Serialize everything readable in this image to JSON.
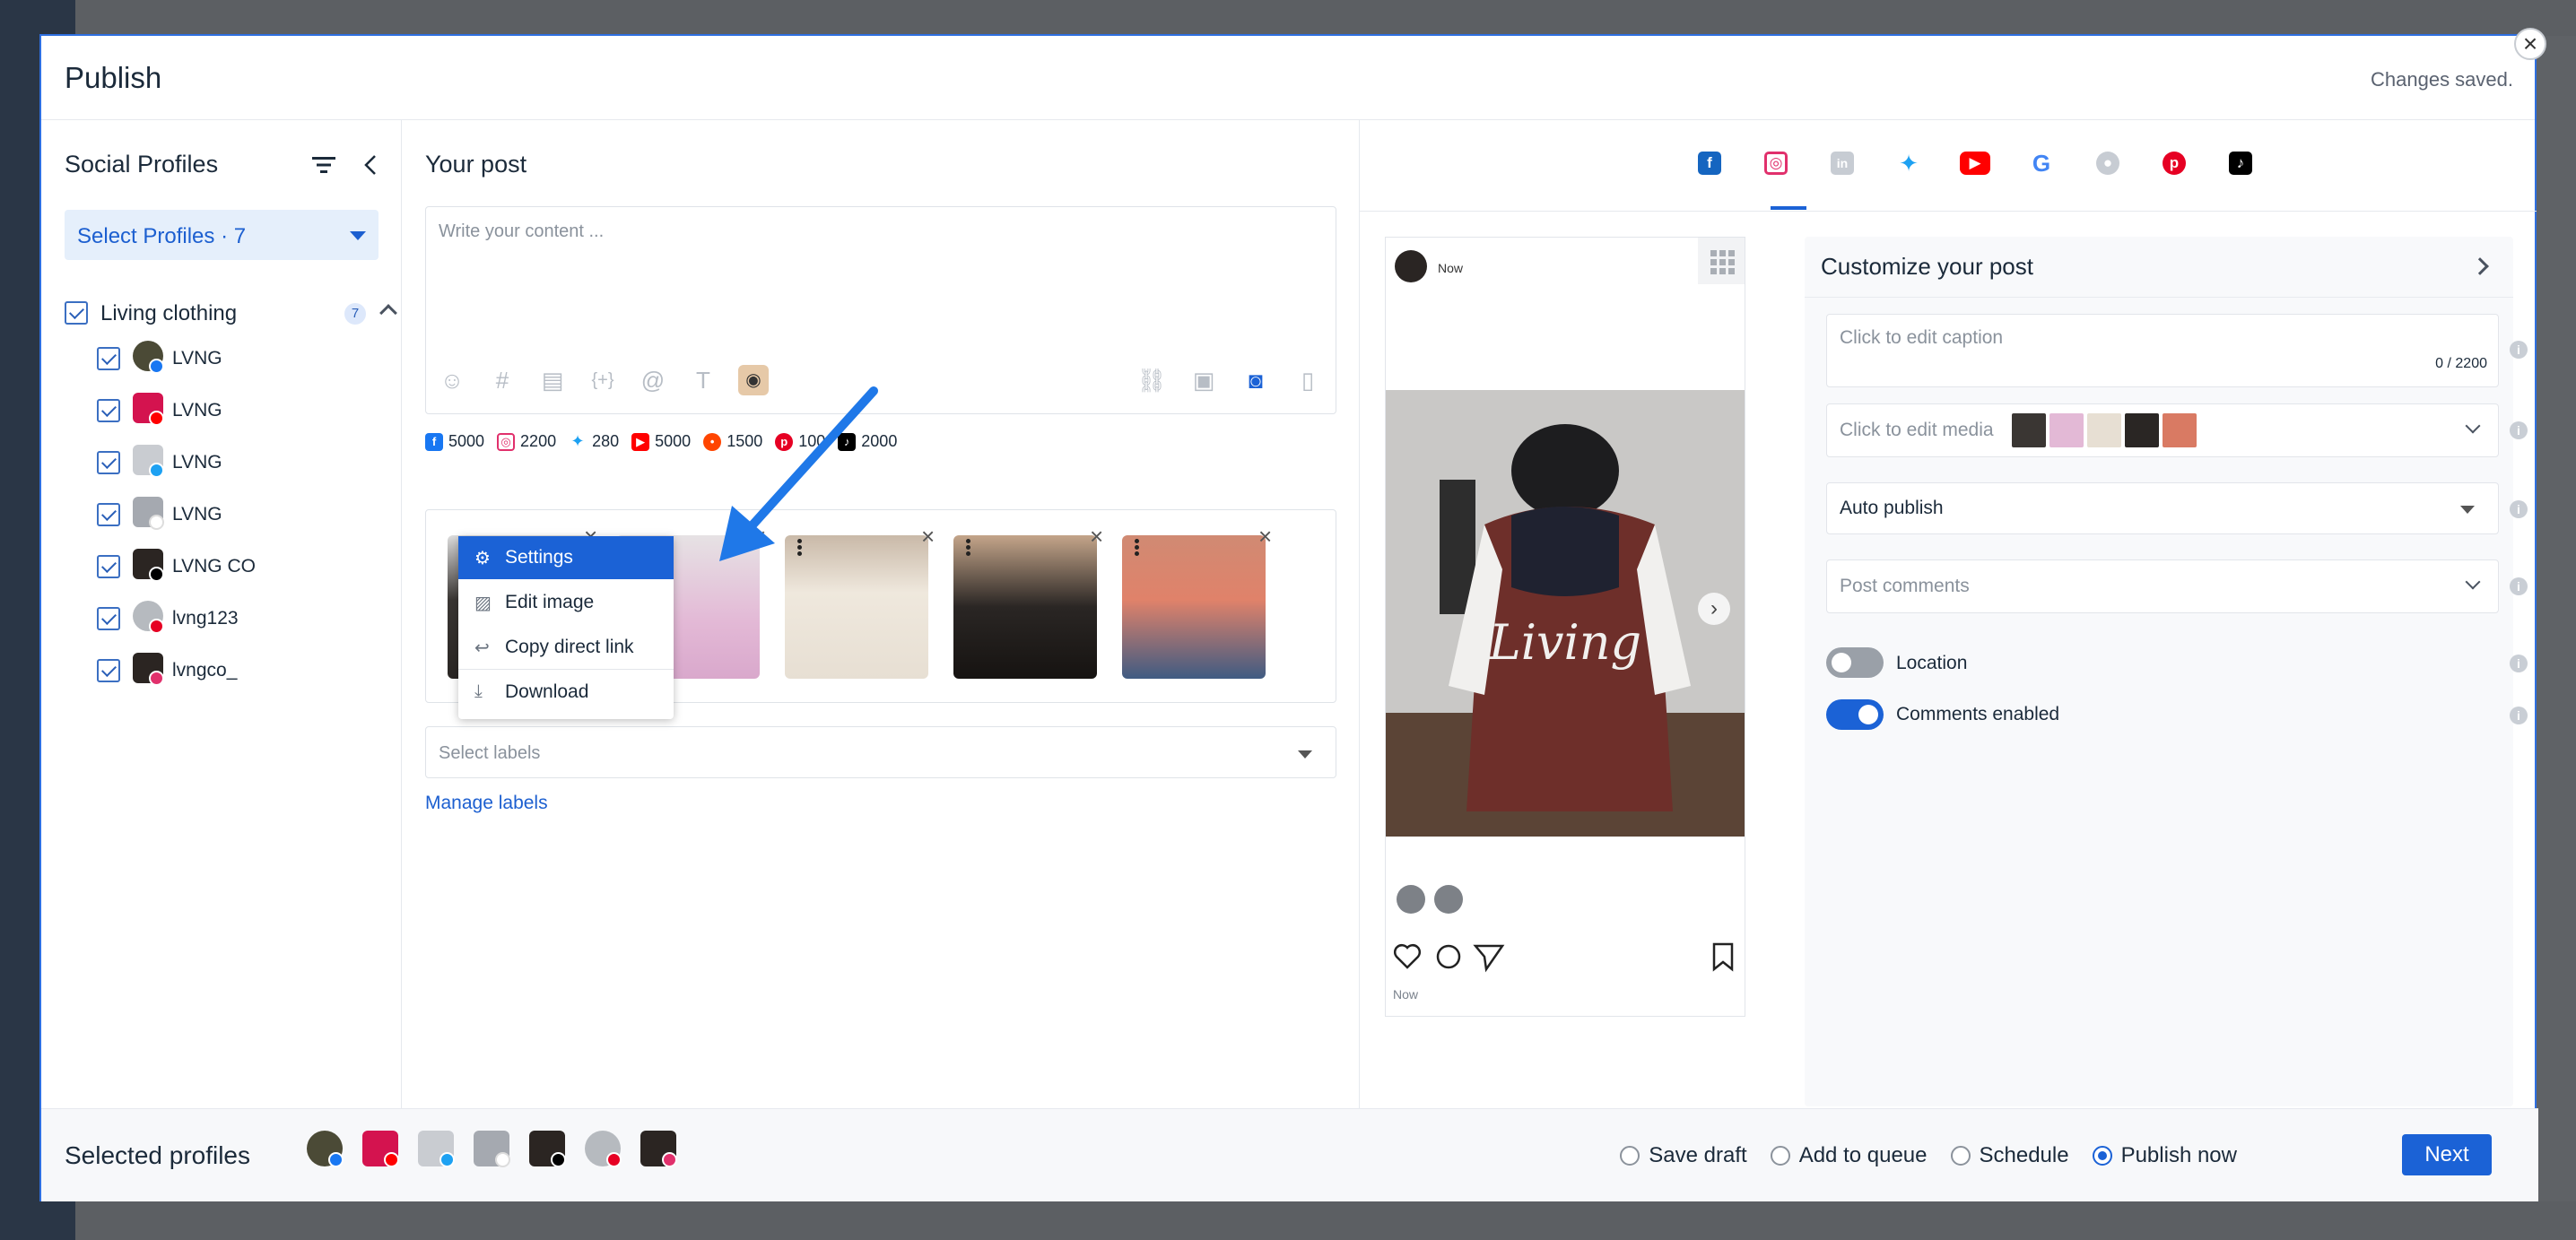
{
  "modal": {
    "title": "Publish",
    "status": "Changes saved."
  },
  "left": {
    "title": "Social Profiles",
    "select_label": "Select Profiles · 7",
    "group": {
      "name": "Living clothing",
      "count": "7"
    },
    "profiles": [
      {
        "name": "LVNG",
        "network": "facebook",
        "avatar_color": "#4b4a36"
      },
      {
        "name": "LVNG",
        "network": "youtube",
        "avatar_color": "#d4134f"
      },
      {
        "name": "LVNG",
        "network": "twitter",
        "avatar_color": "#c9ccd1"
      },
      {
        "name": "LVNG",
        "network": "google",
        "avatar_color": "#a5a9b0"
      },
      {
        "name": "LVNG CO",
        "network": "tiktok",
        "avatar_color": "#2b2522"
      },
      {
        "name": "lvng123",
        "network": "pinterest",
        "avatar_color": "#b6babf"
      },
      {
        "name": "lvngco_",
        "network": "instagram",
        "avatar_color": "#2b2522"
      }
    ]
  },
  "editor": {
    "title": "Your post",
    "placeholder": "Write your content ...",
    "limits": [
      {
        "network": "facebook",
        "value": "5000",
        "color": "#1877f2"
      },
      {
        "network": "instagram",
        "value": "2200",
        "color": "#e1306c"
      },
      {
        "network": "twitter",
        "value": "280",
        "color": "#1da1f2"
      },
      {
        "network": "youtube",
        "value": "5000",
        "color": "#ff0000"
      },
      {
        "network": "reddit",
        "value": "1500",
        "color": "#ff4500"
      },
      {
        "network": "pinterest",
        "value": "100",
        "color": "#e60023"
      },
      {
        "network": "tiktok",
        "value": "2000",
        "color": "#000000"
      }
    ],
    "labels_placeholder": "Select labels",
    "manage_labels": "Manage labels"
  },
  "context_menu": {
    "items": [
      {
        "label": "Settings",
        "icon": "gear-icon"
      },
      {
        "label": "Edit image",
        "icon": "image-icon"
      },
      {
        "label": "Copy direct link",
        "icon": "reply-icon"
      },
      {
        "label": "Download",
        "icon": "download-icon"
      }
    ]
  },
  "preview": {
    "time_header": "Now",
    "time_footer": "Now"
  },
  "customize": {
    "title": "Customize your post",
    "caption_placeholder": "Click to edit caption",
    "caption_count": "0 / 2200",
    "media_placeholder": "Click to edit media",
    "auto_publish": "Auto publish",
    "post_comments": "Post comments",
    "location_label": "Location",
    "location_on": false,
    "comments_label": "Comments enabled",
    "comments_on": true
  },
  "footer": {
    "title": "Selected profiles",
    "options": [
      {
        "label": "Save draft",
        "selected": false
      },
      {
        "label": "Add to queue",
        "selected": false
      },
      {
        "label": "Schedule",
        "selected": false
      },
      {
        "label": "Publish now",
        "selected": true
      }
    ],
    "next_label": "Next"
  },
  "colors": {
    "accent": "#1b62d6",
    "modal_border": "#2e6fe0"
  }
}
